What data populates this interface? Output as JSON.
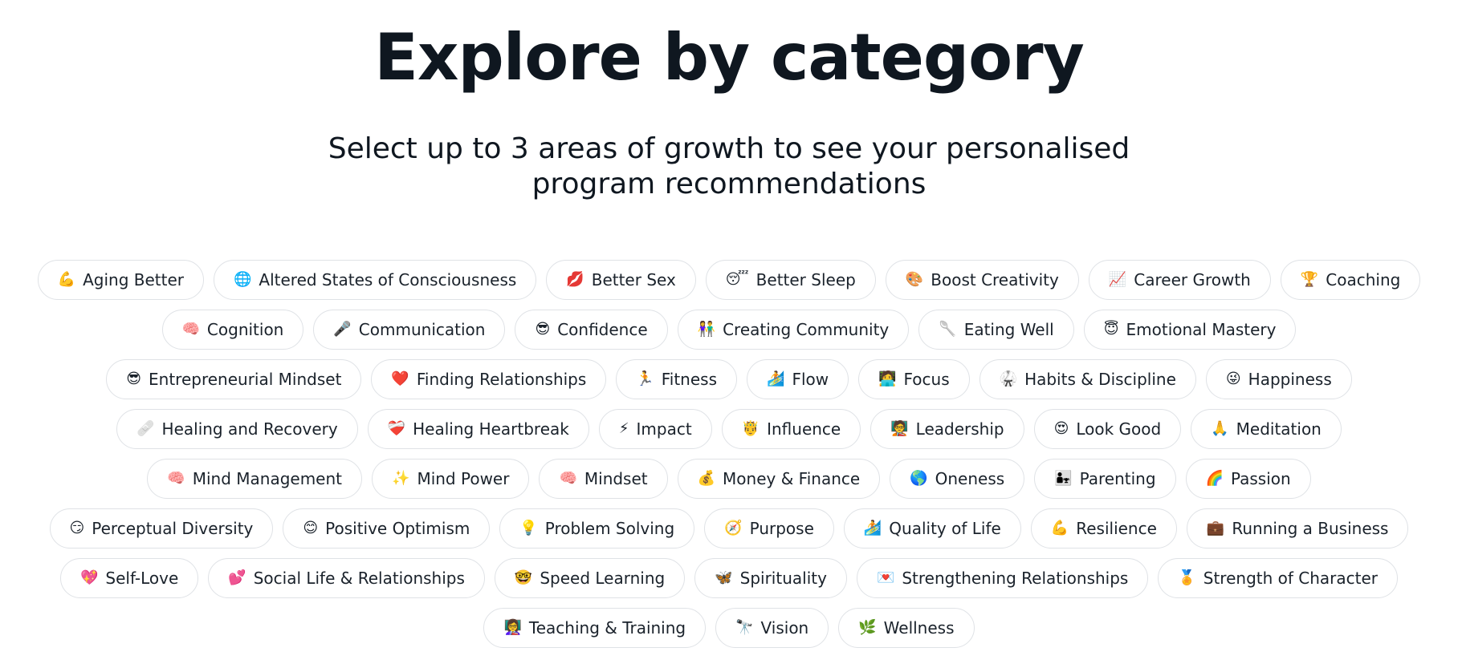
{
  "header": {
    "title": "Explore by category",
    "subtitle": "Select up to 3 areas of growth to see your personalised program recommendations"
  },
  "categories": [
    [
      {
        "icon": "flexed-biceps-icon",
        "glyph": "💪",
        "label": "Aging Better"
      },
      {
        "icon": "brain-web-icon",
        "glyph": "🌐",
        "label": "Altered States of Consciousness"
      },
      {
        "icon": "lips-icon",
        "glyph": "💋",
        "label": "Better Sex"
      },
      {
        "icon": "sleeping-face-icon",
        "glyph": "😴",
        "label": "Better Sleep"
      },
      {
        "icon": "palette-icon",
        "glyph": "🎨",
        "label": "Boost Creativity"
      },
      {
        "icon": "chart-increasing-icon",
        "glyph": "📈",
        "label": "Career Growth"
      },
      {
        "icon": "trophy-icon",
        "glyph": "🏆",
        "label": "Coaching"
      }
    ],
    [
      {
        "icon": "brain-icon",
        "glyph": "🧠",
        "label": "Cognition"
      },
      {
        "icon": "microphone-icon",
        "glyph": "🎤",
        "label": "Communication"
      },
      {
        "icon": "sunglasses-face-icon",
        "glyph": "😎",
        "label": "Confidence"
      },
      {
        "icon": "people-holding-hands-icon",
        "glyph": "👫",
        "label": "Creating Community"
      },
      {
        "icon": "spoon-icon",
        "glyph": "🥄",
        "label": "Eating Well"
      },
      {
        "icon": "halo-face-icon",
        "glyph": "😇",
        "label": "Emotional Mastery"
      }
    ],
    [
      {
        "icon": "sunglasses-face-icon",
        "glyph": "😎",
        "label": "Entrepreneurial Mindset"
      },
      {
        "icon": "red-heart-icon",
        "glyph": "❤️",
        "label": "Finding Relationships"
      },
      {
        "icon": "running-person-icon",
        "glyph": "🏃",
        "label": "Fitness"
      },
      {
        "icon": "surfer-icon",
        "glyph": "🏄",
        "label": "Flow"
      },
      {
        "icon": "person-at-computer-icon",
        "glyph": "🧑‍💻",
        "label": "Focus"
      },
      {
        "icon": "gi-uniform-icon",
        "glyph": "🥋",
        "label": "Habits & Discipline"
      },
      {
        "icon": "grinning-face-icon",
        "glyph": "😜",
        "label": "Happiness"
      }
    ],
    [
      {
        "icon": "bandage-icon",
        "glyph": "🩹",
        "label": "Healing and Recovery"
      },
      {
        "icon": "mending-heart-icon",
        "glyph": "❤️‍🩹",
        "label": "Healing Heartbreak"
      },
      {
        "icon": "lightning-icon",
        "glyph": "⚡",
        "label": "Impact"
      },
      {
        "icon": "crowned-person-icon",
        "glyph": "🤴",
        "label": "Influence"
      },
      {
        "icon": "leader-icon",
        "glyph": "🧑‍🏫",
        "label": "Leadership"
      },
      {
        "icon": "heart-eyes-face-icon",
        "glyph": "😍",
        "label": "Look Good"
      },
      {
        "icon": "praying-hands-icon",
        "glyph": "🙏",
        "label": "Meditation"
      }
    ],
    [
      {
        "icon": "brain-icon",
        "glyph": "🧠",
        "label": "Mind Management"
      },
      {
        "icon": "sparkles-icon",
        "glyph": "✨",
        "label": "Mind Power"
      },
      {
        "icon": "brain-icon",
        "glyph": "🧠",
        "label": "Mindset"
      },
      {
        "icon": "money-bag-icon",
        "glyph": "💰",
        "label": "Money & Finance"
      },
      {
        "icon": "globe-icon",
        "glyph": "🌎",
        "label": "Oneness"
      },
      {
        "icon": "parent-child-icon",
        "glyph": "👨‍👧",
        "label": "Parenting"
      },
      {
        "icon": "rainbow-icon",
        "glyph": "🌈",
        "label": "Passion"
      }
    ],
    [
      {
        "icon": "smirking-face-icon",
        "glyph": "😏",
        "label": "Perceptual Diversity"
      },
      {
        "icon": "smiling-face-icon",
        "glyph": "😊",
        "label": "Positive Optimism"
      },
      {
        "icon": "light-bulb-icon",
        "glyph": "💡",
        "label": "Problem Solving"
      },
      {
        "icon": "compass-icon",
        "glyph": "🧭",
        "label": "Purpose"
      },
      {
        "icon": "surfer-icon",
        "glyph": "🏄",
        "label": "Quality of Life"
      },
      {
        "icon": "flexed-biceps-icon",
        "glyph": "💪",
        "label": "Resilience"
      },
      {
        "icon": "briefcase-icon",
        "glyph": "💼",
        "label": "Running a Business"
      }
    ],
    [
      {
        "icon": "heart-icon",
        "glyph": "💖",
        "label": "Self-Love"
      },
      {
        "icon": "two-hearts-icon",
        "glyph": "💕",
        "label": "Social Life & Relationships"
      },
      {
        "icon": "nerd-face-icon",
        "glyph": "🤓",
        "label": "Speed Learning"
      },
      {
        "icon": "butterfly-icon",
        "glyph": "🦋",
        "label": "Spirituality"
      },
      {
        "icon": "love-letter-icon",
        "glyph": "💌",
        "label": "Strengthening Relationships"
      },
      {
        "icon": "medal-icon",
        "glyph": "🏅",
        "label": "Strength of Character"
      }
    ],
    [
      {
        "icon": "teacher-icon",
        "glyph": "👩‍🏫",
        "label": "Teaching & Training"
      },
      {
        "icon": "telescope-icon",
        "glyph": "🔭",
        "label": "Vision"
      },
      {
        "icon": "herb-icon",
        "glyph": "🌿",
        "label": "Wellness"
      }
    ]
  ]
}
